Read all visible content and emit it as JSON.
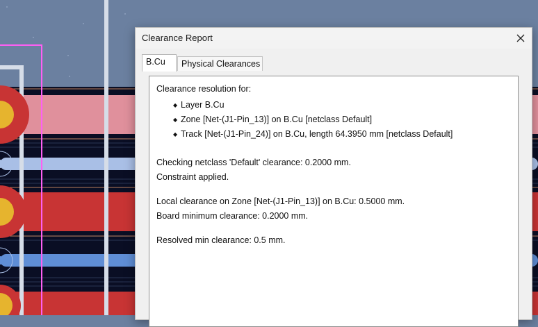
{
  "dialog": {
    "title": "Clearance Report",
    "close_icon": "close-icon"
  },
  "tabs": [
    {
      "label": "B.Cu",
      "active": true
    },
    {
      "label": "Physical Clearances",
      "active": false
    }
  ],
  "report": {
    "heading": "Clearance resolution for:",
    "items": [
      "Layer B.Cu",
      "Zone [Net-(J1-Pin_13)] on B.Cu [netclass Default]",
      "Track [Net-(J1-Pin_24)] on B.Cu, length 64.3950 mm [netclass Default]"
    ],
    "netclass_check": "Checking netclass 'Default' clearance: 0.2000 mm.",
    "constraint": "Constraint applied.",
    "local_clearance": "Local clearance on Zone [Net-(J1-Pin_13)] on B.Cu: 0.5000 mm.",
    "board_min": "Board minimum clearance: 0.2000 mm.",
    "resolved": "Resolved min clearance: 0.5 mm."
  },
  "colors": {
    "board_bg": "#6b80a0",
    "copper_red": "#c83434",
    "copper_pink": "#e0909c",
    "track_blue": "#a9bfe6",
    "pad_yellow": "#e6b42e",
    "courtyard_magenta": "#ff5ff4"
  }
}
